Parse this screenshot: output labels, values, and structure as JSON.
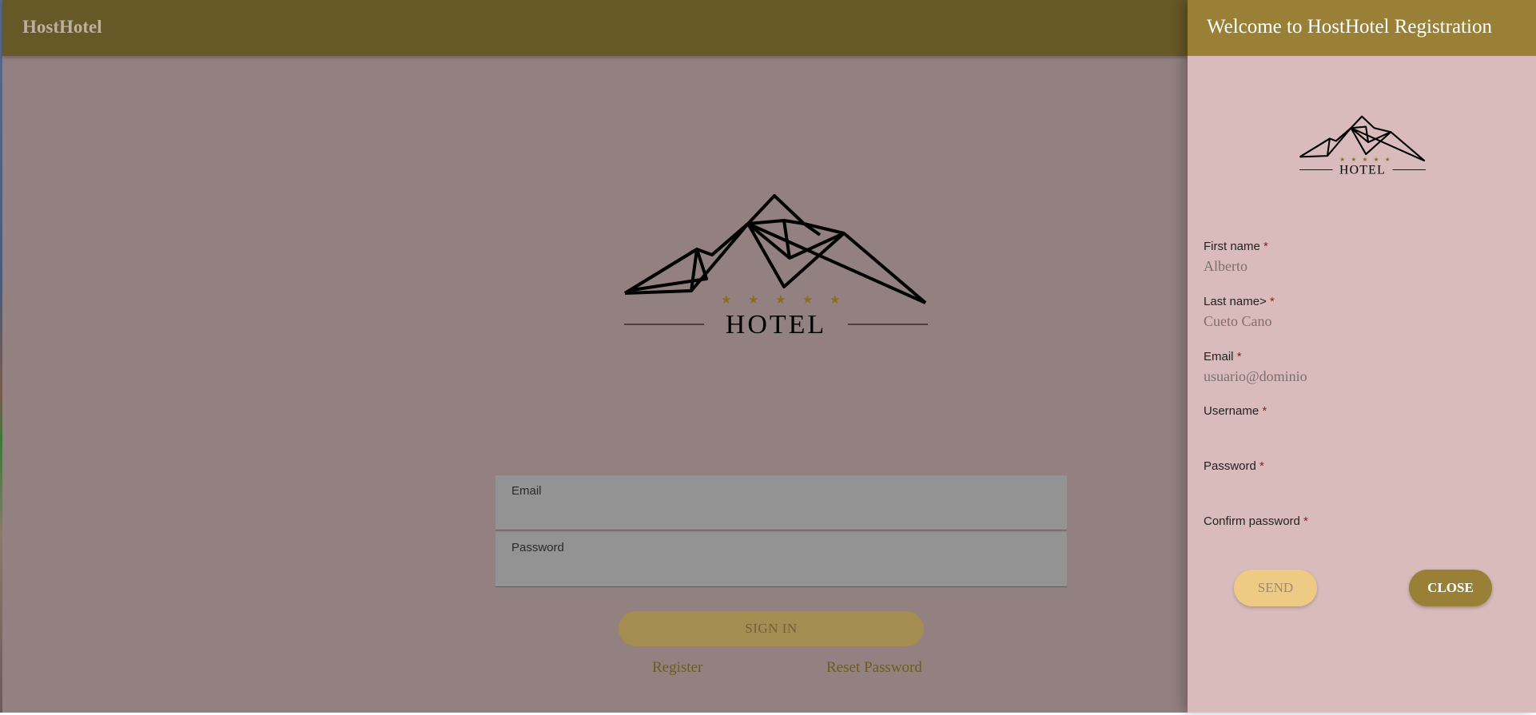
{
  "app": {
    "brand": "HostHotel"
  },
  "hero": {
    "logo_text": "HOTEL",
    "stars": "★ ★ ★ ★ ★"
  },
  "login": {
    "email_label": "Email",
    "email_value": "",
    "password_label": "Password",
    "password_value": "",
    "signin_label": "SIGN IN",
    "register_link": "Register",
    "reset_link": "Reset Password"
  },
  "registration": {
    "title": "Welcome to HostHotel Registration",
    "logo_text": "HOTEL",
    "required_marker": "*",
    "fields": [
      {
        "label": "First name",
        "value": "Alberto"
      },
      {
        "label": "Last name>",
        "value": "Cueto Cano"
      },
      {
        "label": "Email",
        "value": "usuario@dominio"
      },
      {
        "label": "Username",
        "value": ""
      },
      {
        "label": "Password",
        "value": ""
      },
      {
        "label": "Confirm password",
        "value": ""
      }
    ],
    "send_label": "SEND",
    "close_label": "CLOSE"
  },
  "colors": {
    "topbar": "#665827",
    "panel_header": "#9a7f36",
    "panel_background": "#d9bbbb",
    "overlay_background": "#938080",
    "send_button": "#eecb84",
    "close_button": "#9a7f36",
    "star": "#8a6d1f"
  },
  "icons": {
    "hero_logo": "mountain-hotel-logo-icon",
    "panel_logo": "mountain-hotel-logo-icon"
  }
}
